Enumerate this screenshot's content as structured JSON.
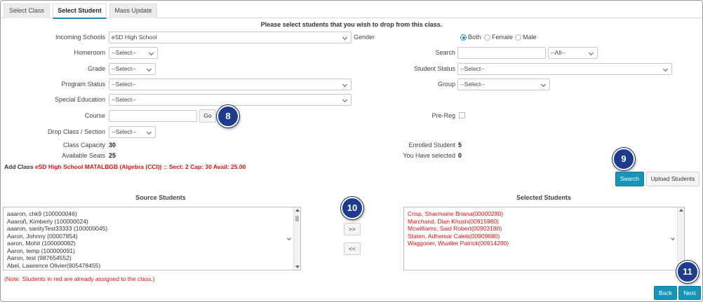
{
  "tabs": [
    {
      "label": "Select Class"
    },
    {
      "label": "Select Student"
    },
    {
      "label": "Mass Update"
    }
  ],
  "instruction": "Please select students that you wish to drop from this class.",
  "form": {
    "incoming_schools": {
      "label": "Incoming Schools",
      "value": "eSD High School"
    },
    "gender": {
      "label": "Gender",
      "options": [
        "Both",
        "Female",
        "Male"
      ],
      "selected": "Both"
    },
    "homeroom": {
      "label": "Homeroom",
      "value": "--Select--"
    },
    "search": {
      "label": "Search",
      "value": "",
      "filter": "--All--"
    },
    "grade": {
      "label": "Grade",
      "value": "--Select--"
    },
    "student_status": {
      "label": "Student Status",
      "value": "--Select--"
    },
    "program_status": {
      "label": "Program Status",
      "value": "--Select--"
    },
    "group": {
      "label": "Group",
      "value": "--Select--"
    },
    "special_education": {
      "label": "Special Education",
      "value": "--Select--"
    },
    "course": {
      "label": "Course",
      "value": "",
      "go_label": "Go"
    },
    "pre_reg": {
      "label": "Pre-Reg",
      "checked": false
    },
    "drop_class_section": {
      "label": "Drop Class / Section",
      "value": "--Select--"
    },
    "class_capacity": {
      "label": "Class Capacity",
      "value": "30"
    },
    "enrolled_student": {
      "label": "Enrolled Student",
      "value": "5"
    },
    "available_seats": {
      "label": "Available Seats",
      "value": "25"
    },
    "you_have_selected": {
      "label": "You Have selected",
      "value": "0"
    }
  },
  "add_class": {
    "prefix": "Add Class",
    "detail": "eSD High School MATALBGB (Algebra (CCI)) :: Sect: 2 Cap: 30 Avail: 25.00"
  },
  "buttons": {
    "search": "Search",
    "upload_students": "Upload Students",
    "move_right": ">>",
    "move_left": "<<",
    "back": "Back",
    "next": "Next"
  },
  "source_students": {
    "title": "Source Students",
    "items": [
      "aaaron, chk9 (100000046)",
      "Aaaroñ, Kimberly (100000024)",
      "aaaron, sanityTest33333 (100000045)",
      "Aaron, Johnny (00007854)",
      "aaron, Mohit (100000082)",
      "Aaron, temp (100000091)",
      "Aaron, test (987654552)",
      "Abel, Lawrence Olivier(905478455)"
    ]
  },
  "selected_students": {
    "title": "Selected Students",
    "items": [
      "Crisp, Sharmaine Briana(00000280)",
      "Marchand, Dian Khush(00915980)",
      "Mcwilliams, Said Robert(00903180)",
      "Staten, Adhemar Caleb(00909680)",
      "Waggoner, Wualter Patrick(00914280)"
    ]
  },
  "note": "(Note: Students in red are already assigned to the class.)",
  "callouts": [
    "8",
    "9",
    "10",
    "11"
  ],
  "colors": {
    "accent": "#1795b8",
    "callout": "#1e3b8c",
    "warning_red": "#dd1111"
  }
}
